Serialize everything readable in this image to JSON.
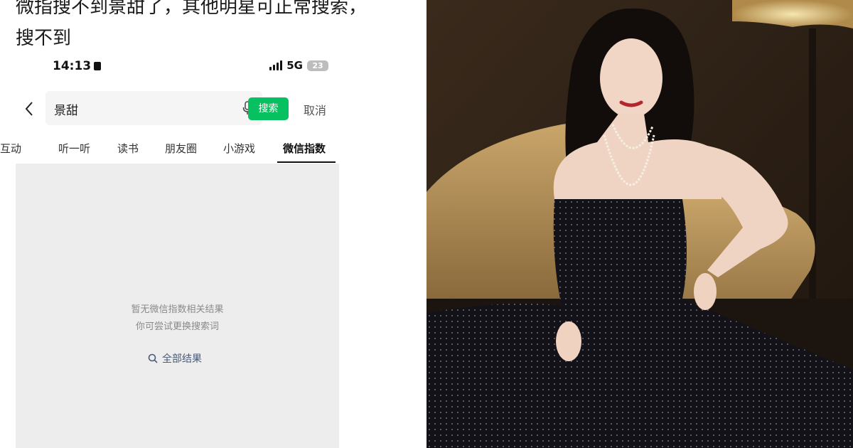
{
  "caption": {
    "line1": "微指搜不到景甜了，其他明星可正常搜索，",
    "line2": "搜不到"
  },
  "status_bar": {
    "time": "14:13",
    "network": "5G",
    "battery": "23"
  },
  "search": {
    "query": "景甜",
    "search_button": "搜索",
    "cancel_button": "取消"
  },
  "tabs": [
    {
      "label": "互动"
    },
    {
      "label": "听一听"
    },
    {
      "label": "读书"
    },
    {
      "label": "朋友圈"
    },
    {
      "label": "小游戏"
    },
    {
      "label": "微信指数"
    }
  ],
  "results": {
    "empty_primary": "暂无微信指数相关结果",
    "empty_secondary": "你可尝试更换搜索词",
    "all_results_link": "全部结果"
  },
  "icons": {
    "back": "chevron-left-icon",
    "mic": "microphone-icon",
    "search": "magnifier-icon"
  },
  "colors": {
    "accent_green": "#07c160",
    "panel_gray": "#ededed"
  }
}
